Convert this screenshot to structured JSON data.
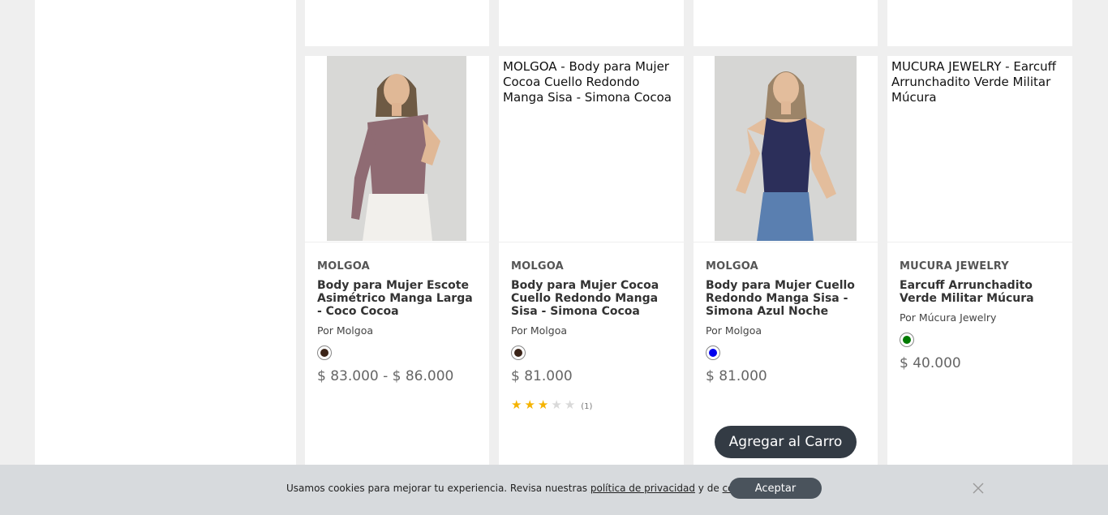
{
  "products": [
    {
      "brand": "MOLGOA",
      "title": "Body para Mujer Escote Asimétrico Manga Larga - Coco Cocoa",
      "by": "Por Molgoa",
      "swatch_color": "#3b2418",
      "price": "$ 83.000 - $ 86.000",
      "image": "photo-woman-mauve-one-shoulder-bodysuit"
    },
    {
      "brand": "MOLGOA",
      "title": "Body para Mujer Cocoa Cuello Redondo Manga Sisa - Simona Cocoa",
      "image_alt": "MOLGOA - Body para Mujer Cocoa Cuello Redondo Manga Sisa - Simona Cocoa",
      "by": "Por Molgoa",
      "swatch_color": "#3b2418",
      "price": "$ 81.000",
      "rating": 3,
      "rating_max": 5,
      "rating_count": "(1)"
    },
    {
      "brand": "MOLGOA",
      "title": "Body para Mujer Cuello Redondo Manga Sisa - Simona Azul Noche",
      "by": "Por Molgoa",
      "swatch_color": "#0000ee",
      "price": "$ 81.000",
      "button": "Agregar al Carro",
      "image": "photo-woman-navy-sleeveless-bodysuit"
    },
    {
      "brand": "MUCURA JEWELRY",
      "title": "Earcuff Arrunchadito Verde Militar Múcura",
      "image_alt": "MUCURA JEWELRY - Earcuff Arrunchadito Verde Militar Múcura",
      "by": "Por Múcura Jewelry",
      "swatch_color": "#007a00",
      "price": "$ 40.000"
    }
  ],
  "cookie": {
    "text_before": "Usamos cookies para mejorar tu experiencia. Revisa nuestras ",
    "privacy_link": "política de privacidad",
    "text_middle": " y de ",
    "cookies_link": "cookies",
    "text_after": ".",
    "accept": "Aceptar",
    "close_icon": "close-icon"
  }
}
